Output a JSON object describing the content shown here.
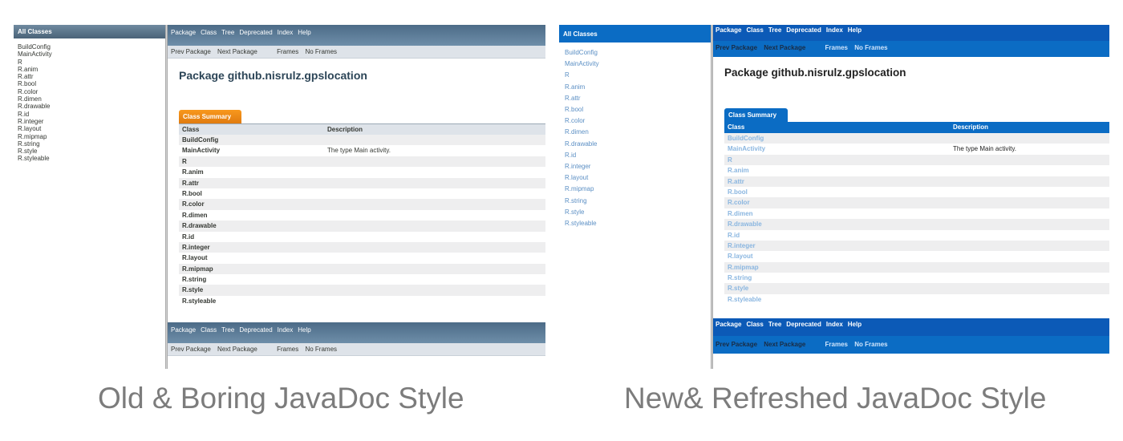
{
  "old": {
    "all_classes": "All Classes",
    "classes": [
      "BuildConfig",
      "MainActivity",
      "R",
      "R.anim",
      "R.attr",
      "R.bool",
      "R.color",
      "R.dimen",
      "R.drawable",
      "R.id",
      "R.integer",
      "R.layout",
      "R.mipmap",
      "R.string",
      "R.style",
      "R.styleable"
    ],
    "nav": [
      "Package",
      "Class",
      "Tree",
      "Deprecated",
      "Index",
      "Help"
    ],
    "subnav": [
      "Prev Package",
      "Next Package",
      "Frames",
      "No Frames"
    ],
    "title": "Package github.nisrulz.gpslocation",
    "tab": "Class Summary",
    "table_header": [
      "Class",
      "Description"
    ],
    "rows": [
      [
        "BuildConfig",
        ""
      ],
      [
        "MainActivity",
        "The type Main activity."
      ],
      [
        "R",
        ""
      ],
      [
        "R.anim",
        ""
      ],
      [
        "R.attr",
        ""
      ],
      [
        "R.bool",
        ""
      ],
      [
        "R.color",
        ""
      ],
      [
        "R.dimen",
        ""
      ],
      [
        "R.drawable",
        ""
      ],
      [
        "R.id",
        ""
      ],
      [
        "R.integer",
        ""
      ],
      [
        "R.layout",
        ""
      ],
      [
        "R.mipmap",
        ""
      ],
      [
        "R.string",
        ""
      ],
      [
        "R.style",
        ""
      ],
      [
        "R.styleable",
        ""
      ]
    ]
  },
  "new": {
    "all_classes": "All Classes",
    "classes": [
      "BuildConfig",
      "MainActivity",
      "R",
      "R.anim",
      "R.attr",
      "R.bool",
      "R.color",
      "R.dimen",
      "R.drawable",
      "R.id",
      "R.integer",
      "R.layout",
      "R.mipmap",
      "R.string",
      "R.style",
      "R.styleable"
    ],
    "nav": [
      "Package",
      "Class",
      "Tree",
      "Deprecated",
      "Index",
      "Help"
    ],
    "subnav": [
      "Prev Package",
      "Next Package",
      "Frames",
      "No Frames"
    ],
    "title": "Package github.nisrulz.gpslocation",
    "tab": "Class Summary",
    "table_header": [
      "Class",
      "Description"
    ],
    "rows": [
      [
        "BuildConfig",
        ""
      ],
      [
        "MainActivity",
        "The type Main activity."
      ],
      [
        "R",
        ""
      ],
      [
        "R.anim",
        ""
      ],
      [
        "R.attr",
        ""
      ],
      [
        "R.bool",
        ""
      ],
      [
        "R.color",
        ""
      ],
      [
        "R.dimen",
        ""
      ],
      [
        "R.drawable",
        ""
      ],
      [
        "R.id",
        ""
      ],
      [
        "R.integer",
        ""
      ],
      [
        "R.layout",
        ""
      ],
      [
        "R.mipmap",
        ""
      ],
      [
        "R.string",
        ""
      ],
      [
        "R.style",
        ""
      ],
      [
        "R.styleable",
        ""
      ]
    ]
  },
  "captions": {
    "old": "Old & Boring JavaDoc Style",
    "new": "New& Refreshed JavaDoc Style"
  },
  "colors": {
    "old_nav": "#4c6b87",
    "old_tab": "#f8981d",
    "new_nav": "#0c5ab7",
    "new_accent": "#0b6cc4"
  }
}
